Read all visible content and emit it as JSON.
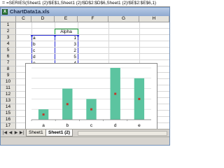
{
  "formula_bar": {
    "icon": "function-icon",
    "text": "=SERIES(Sheet1 (2)!$E$1,Sheet1 (2)!$D$2:$D$6,Sheet1 (2)!$E$2:$E$6,1)"
  },
  "window": {
    "title": "ChartData1a.xls",
    "doc_icon_glyph": "X"
  },
  "grid": {
    "col_headers": [
      "C",
      "D",
      "E",
      "F",
      "G",
      "H"
    ],
    "row_headers": [
      "1",
      "2",
      "3",
      "4",
      "5",
      "6",
      "7",
      "8",
      "9",
      "10",
      "11",
      "12",
      "13",
      "14",
      "15",
      "16",
      "17"
    ],
    "cells": {
      "E1": "Alpha",
      "D2": "a",
      "E2": "1",
      "D3": "b",
      "E3": "3",
      "D4": "c",
      "E4": "2",
      "D5": "d",
      "E5": "5",
      "D6": "e",
      "E6": "4"
    }
  },
  "chart_data": {
    "type": "bar",
    "categories": [
      "a",
      "b",
      "c",
      "d",
      "e"
    ],
    "values": [
      1,
      3,
      2,
      5,
      4
    ],
    "series": [
      {
        "values": [
          1,
          3,
          2,
          5,
          4
        ]
      }
    ],
    "ylim": [
      0,
      5
    ],
    "grid": true,
    "bar_color": "#5cc4a0",
    "marker_color": "#c0392b",
    "selected_series": true
  },
  "tabs": {
    "nav": [
      "|◀",
      "◀",
      "▶",
      "▶|"
    ],
    "sheets": [
      "Sheet1",
      "Sheet1 (2)"
    ],
    "active": "Sheet1 (2)"
  }
}
